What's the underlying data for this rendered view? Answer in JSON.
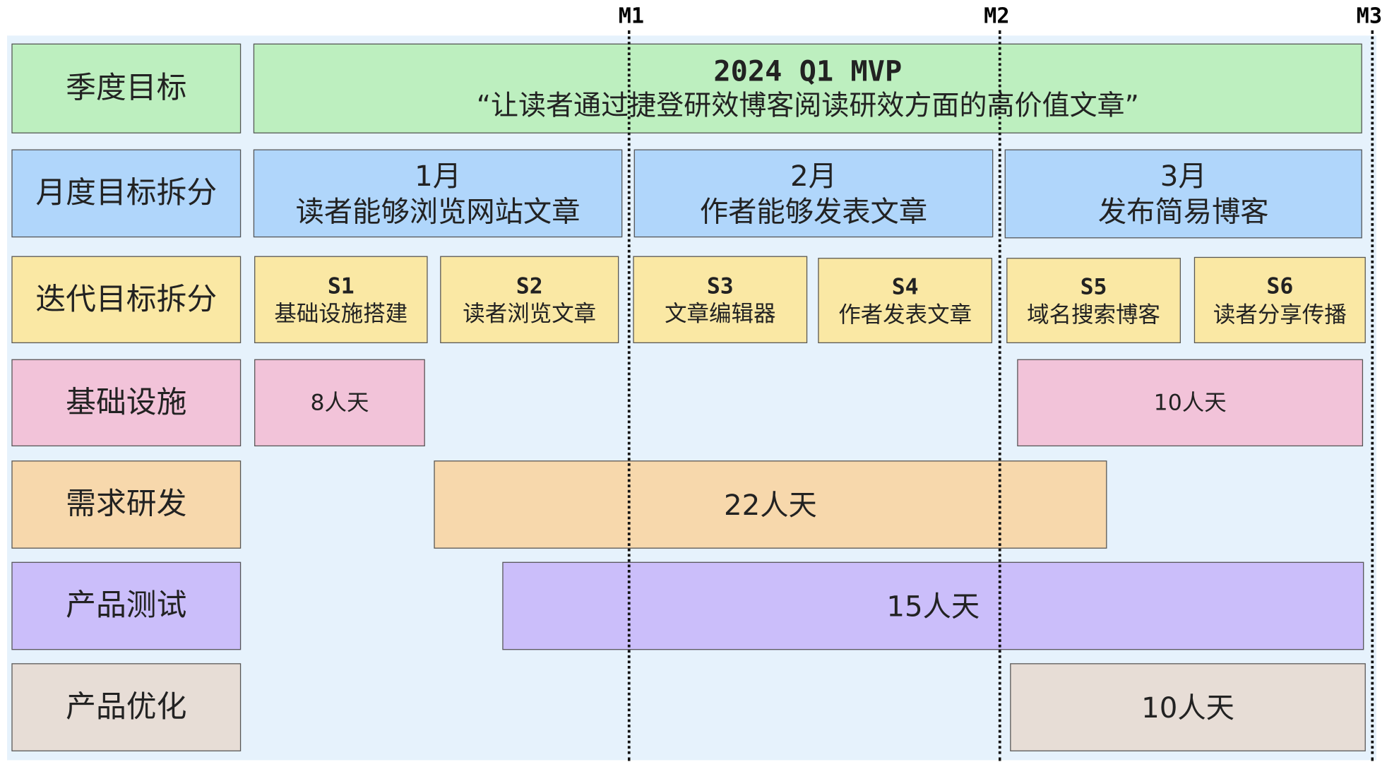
{
  "milestones": [
    "M1",
    "M2",
    "M3"
  ],
  "rows": {
    "quarter": "季度目标",
    "month": "月度目标拆分",
    "iteration": "迭代目标拆分",
    "infra": "基础设施",
    "dev": "需求研发",
    "test": "产品测试",
    "opt": "产品优化"
  },
  "quarter": {
    "title": "2024 Q1 MVP",
    "goal": "“让读者通过捷登研效博客阅读研效方面的高价值文章”"
  },
  "months": [
    {
      "name": "1月",
      "goal": "读者能够浏览网站文章"
    },
    {
      "name": "2月",
      "goal": "作者能够发表文章"
    },
    {
      "name": "3月",
      "goal": "发布简易博客"
    }
  ],
  "sprints": [
    {
      "name": "S1",
      "goal": "基础设施搭建"
    },
    {
      "name": "S2",
      "goal": "读者浏览文章"
    },
    {
      "name": "S3",
      "goal": "文章编辑器"
    },
    {
      "name": "S4",
      "goal": "作者发表文章"
    },
    {
      "name": "S5",
      "goal": "域名搜索博客"
    },
    {
      "name": "S6",
      "goal": "读者分享传播"
    }
  ],
  "effort": {
    "infra_1": "8人天",
    "infra_2": "10人天",
    "dev": "22人天",
    "test": "15人天",
    "opt": "10人天"
  },
  "colors": {
    "quarter": "#bdefbf",
    "month": "#b0d6fb",
    "iteration": "#fae8a4",
    "infra": "#f2c3d9",
    "dev": "#f7d8ac",
    "test": "#cbbefa",
    "opt": "#e7ddd6",
    "background": "#e6f2fc"
  }
}
